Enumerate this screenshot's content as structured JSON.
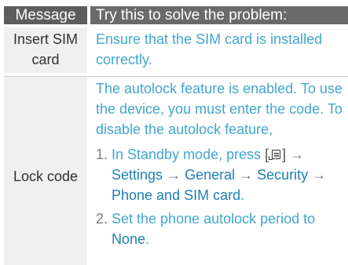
{
  "header": {
    "message": "Message",
    "action": "Try this to solve the problem:"
  },
  "rows": [
    {
      "message": "Insert SIM card",
      "action": "Ensure that the SIM card is installed correctly."
    },
    {
      "message": "Lock code",
      "intro": "The autolock feature is enabled. To use the device, you must enter the code. To disable the autolock feature,",
      "steps": [
        {
          "number": "1.",
          "text_before": "In Standby mode, press",
          "bracket_open": "[",
          "icon": "menu-key-icon",
          "bracket_close": "]",
          "arrow": "→",
          "menu_path": [
            "Settings",
            "General",
            "Security",
            "Phone and SIM card"
          ],
          "end": "."
        },
        {
          "number": "2.",
          "text": "Set the phone autolock period to",
          "value": "None",
          "end": "."
        }
      ]
    }
  ],
  "colors": {
    "header_bg": "#5d5d5d",
    "message_col_bg": "#f0f0f0",
    "action_text": "#42a7cd",
    "key_text": "#1f7fb3"
  }
}
